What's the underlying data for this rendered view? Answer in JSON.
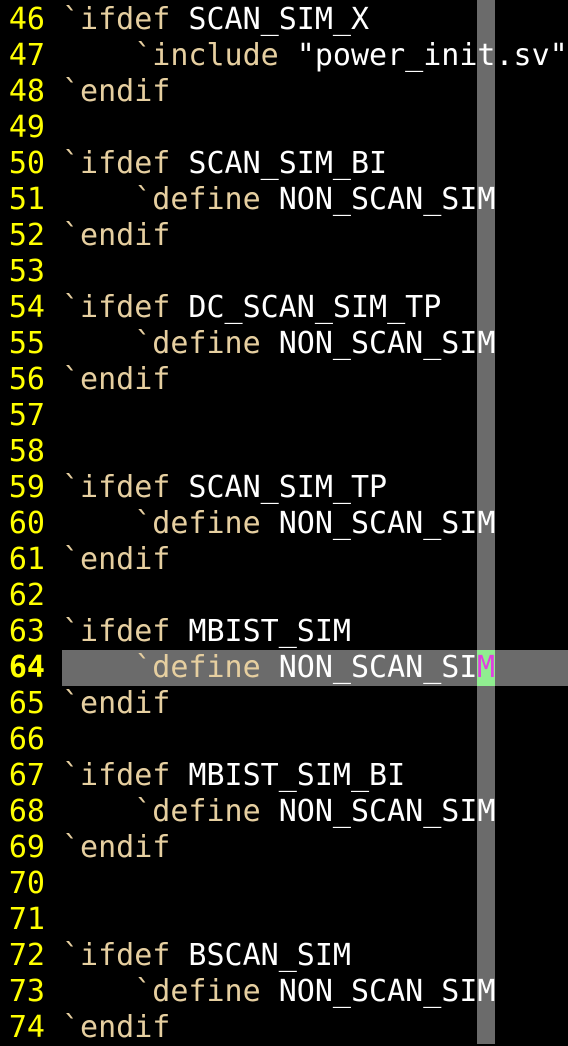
{
  "editor": {
    "colors": {
      "line_number": "#ffff00",
      "keyword": "#e6cfa0",
      "identifier": "#ffffff",
      "cursorline": "#6b6b6b",
      "colorcolumn": "#6b6b6b",
      "cursor": "#90ee90",
      "cursor_char": "#e040e0"
    },
    "current_line": 64,
    "cursor_char": "M",
    "lines": [
      {
        "num": "46",
        "segs": [
          {
            "t": "`ifdef",
            "s": "kw"
          },
          {
            "t": " SCAN_SIM_X",
            "s": "id"
          }
        ]
      },
      {
        "num": "47",
        "segs": [
          {
            "t": "    `include",
            "s": "kw"
          },
          {
            "t": " \"power_init.sv\"",
            "s": "str"
          }
        ]
      },
      {
        "num": "48",
        "segs": [
          {
            "t": "`endif",
            "s": "kw"
          }
        ]
      },
      {
        "num": "49",
        "segs": []
      },
      {
        "num": "50",
        "segs": [
          {
            "t": "`ifdef",
            "s": "kw"
          },
          {
            "t": " SCAN_SIM_BI",
            "s": "id"
          }
        ]
      },
      {
        "num": "51",
        "segs": [
          {
            "t": "    `define",
            "s": "kw"
          },
          {
            "t": " NON_SCAN_SIM",
            "s": "id"
          }
        ]
      },
      {
        "num": "52",
        "segs": [
          {
            "t": "`endif",
            "s": "kw"
          }
        ]
      },
      {
        "num": "53",
        "segs": []
      },
      {
        "num": "54",
        "segs": [
          {
            "t": "`ifdef",
            "s": "kw"
          },
          {
            "t": " DC_SCAN_SIM_TP",
            "s": "id"
          }
        ]
      },
      {
        "num": "55",
        "segs": [
          {
            "t": "    `define",
            "s": "kw"
          },
          {
            "t": " NON_SCAN_SIM",
            "s": "id"
          }
        ]
      },
      {
        "num": "56",
        "segs": [
          {
            "t": "`endif",
            "s": "kw"
          }
        ]
      },
      {
        "num": "57",
        "segs": []
      },
      {
        "num": "58",
        "segs": []
      },
      {
        "num": "59",
        "segs": [
          {
            "t": "`ifdef",
            "s": "kw"
          },
          {
            "t": " SCAN_SIM_TP",
            "s": "id"
          }
        ]
      },
      {
        "num": "60",
        "segs": [
          {
            "t": "    `define",
            "s": "kw"
          },
          {
            "t": " NON_SCAN_SIM",
            "s": "id"
          }
        ]
      },
      {
        "num": "61",
        "segs": [
          {
            "t": "`endif",
            "s": "kw"
          }
        ]
      },
      {
        "num": "62",
        "segs": []
      },
      {
        "num": "63",
        "segs": [
          {
            "t": "`ifdef",
            "s": "kw"
          },
          {
            "t": " MBIST_SIM",
            "s": "id"
          }
        ]
      },
      {
        "num": "64",
        "segs": [
          {
            "t": "    `define",
            "s": "kw"
          },
          {
            "t": " NON_SCAN_SI",
            "s": "id"
          }
        ]
      },
      {
        "num": "65",
        "segs": [
          {
            "t": "`endif",
            "s": "kw"
          }
        ]
      },
      {
        "num": "66",
        "segs": []
      },
      {
        "num": "67",
        "segs": [
          {
            "t": "`ifdef",
            "s": "kw"
          },
          {
            "t": " MBIST_SIM_BI",
            "s": "id"
          }
        ]
      },
      {
        "num": "68",
        "segs": [
          {
            "t": "    `define",
            "s": "kw"
          },
          {
            "t": " NON_SCAN_SIM",
            "s": "id"
          }
        ]
      },
      {
        "num": "69",
        "segs": [
          {
            "t": "`endif",
            "s": "kw"
          }
        ]
      },
      {
        "num": "70",
        "segs": []
      },
      {
        "num": "71",
        "segs": []
      },
      {
        "num": "72",
        "segs": [
          {
            "t": "`ifdef",
            "s": "kw"
          },
          {
            "t": " BSCAN_SIM",
            "s": "id"
          }
        ]
      },
      {
        "num": "73",
        "segs": [
          {
            "t": "    `define",
            "s": "kw"
          },
          {
            "t": " NON_SCAN_SIM",
            "s": "id"
          }
        ]
      },
      {
        "num": "74",
        "segs": [
          {
            "t": "`endif",
            "s": "kw"
          }
        ]
      }
    ]
  }
}
